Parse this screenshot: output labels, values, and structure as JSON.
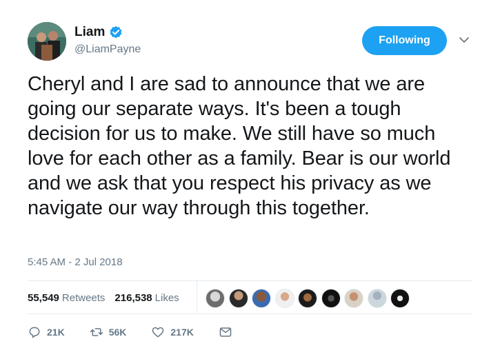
{
  "author": {
    "name": "Liam",
    "handle": "@LiamPayne",
    "verified": true
  },
  "follow_button": {
    "label": "Following"
  },
  "tweet": {
    "text": "Cheryl and I are sad to announce that we are going our separate ways. It's been a tough decision for us to make. We still have so much love for each other as a family. Bear is our world and we ask that you respect his privacy as we navigate our way through this together.",
    "timestamp": "5:45 AM - 2 Jul 2018"
  },
  "stats": {
    "retweets_count": "55,549",
    "retweets_label": "Retweets",
    "likes_count": "216,538",
    "likes_label": "Likes"
  },
  "actions": {
    "replies": "21K",
    "retweets": "56K",
    "likes": "217K"
  },
  "colors": {
    "accent": "#1da1f2",
    "text": "#14171a",
    "muted": "#657786",
    "divider": "#e6ecf0"
  },
  "icons": [
    "verified-badge-icon",
    "chevron-down-icon",
    "reply-icon",
    "retweet-icon",
    "heart-icon",
    "direct-message-icon"
  ]
}
